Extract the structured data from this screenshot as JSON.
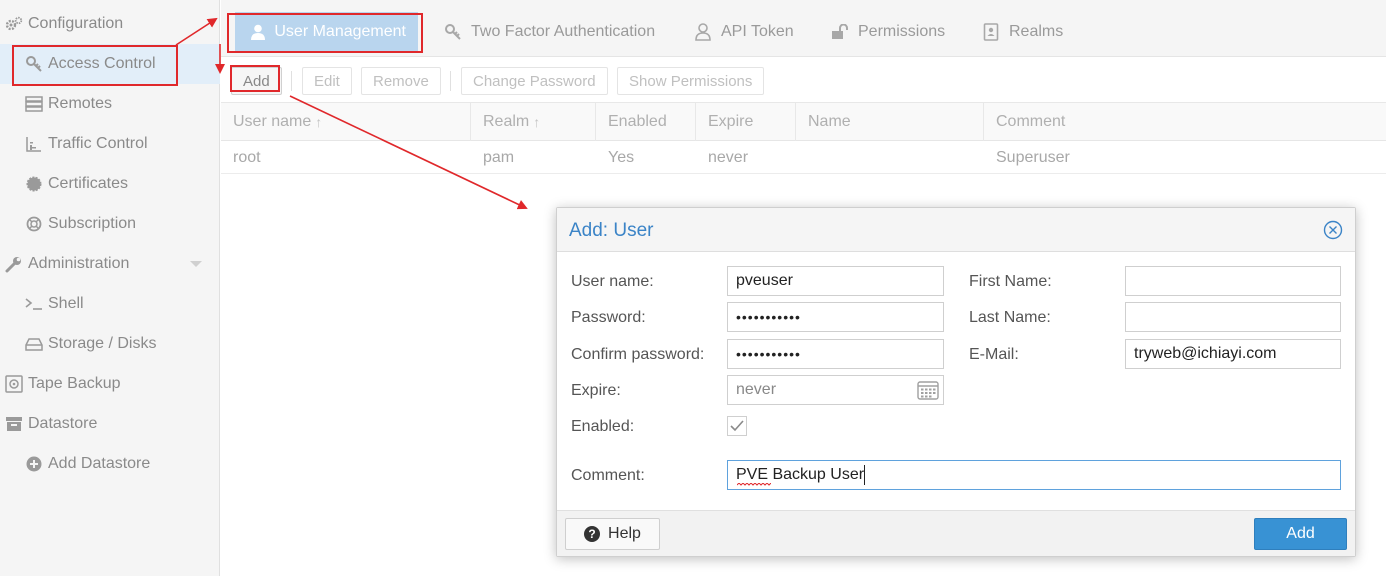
{
  "sidebar": {
    "items": [
      {
        "label": "Configuration",
        "icon": "gears-icon"
      },
      {
        "label": "Access Control",
        "icon": "key-icon"
      },
      {
        "label": "Remotes",
        "icon": "server-icon"
      },
      {
        "label": "Traffic Control",
        "icon": "bar-chart-icon"
      },
      {
        "label": "Certificates",
        "icon": "certificate-icon"
      },
      {
        "label": "Subscription",
        "icon": "lifebuoy-icon"
      },
      {
        "label": "Administration",
        "icon": "wrench-icon"
      },
      {
        "label": "Shell",
        "icon": "terminal-icon"
      },
      {
        "label": "Storage / Disks",
        "icon": "hdd-icon"
      },
      {
        "label": "Tape Backup",
        "icon": "tape-icon"
      },
      {
        "label": "Datastore",
        "icon": "archive-icon"
      },
      {
        "label": "Add Datastore",
        "icon": "plus-circle-icon"
      }
    ]
  },
  "tabs": [
    {
      "label": "User Management",
      "icon": "user-icon"
    },
    {
      "label": "Two Factor Authentication",
      "icon": "key-icon"
    },
    {
      "label": "API Token",
      "icon": "user-outline-icon"
    },
    {
      "label": "Permissions",
      "icon": "unlock-icon"
    },
    {
      "label": "Realms",
      "icon": "address-book-icon"
    }
  ],
  "toolbar": {
    "add": "Add",
    "edit": "Edit",
    "remove": "Remove",
    "change_password": "Change Password",
    "show_permissions": "Show Permissions"
  },
  "grid": {
    "columns": [
      "User name",
      "Realm",
      "Enabled",
      "Expire",
      "Name",
      "Comment"
    ],
    "sort_indicator": "↑",
    "rows": [
      [
        "root",
        "pam",
        "Yes",
        "never",
        "",
        "Superuser"
      ]
    ]
  },
  "dialog": {
    "title": "Add: User",
    "labels": {
      "username": "User name:",
      "password": "Password:",
      "confirm_password": "Confirm password:",
      "expire": "Expire:",
      "enabled": "Enabled:",
      "comment": "Comment:",
      "first_name": "First Name:",
      "last_name": "Last Name:",
      "email": "E-Mail:"
    },
    "values": {
      "username": "pveuser",
      "password": "•••••••••••",
      "confirm_password": "•••••••••••",
      "expire": "never",
      "enabled": true,
      "comment": "PVE Backup User",
      "first_name": "",
      "last_name": "",
      "email": "tryweb@ichiayi.com"
    },
    "help": "Help",
    "submit": "Add"
  },
  "colors": {
    "accent": "#3892d4",
    "title": "#3b84c7",
    "tab_active": "#b9d5ee",
    "selected_row": "#e2eef9",
    "annotation": "#e0282b"
  }
}
